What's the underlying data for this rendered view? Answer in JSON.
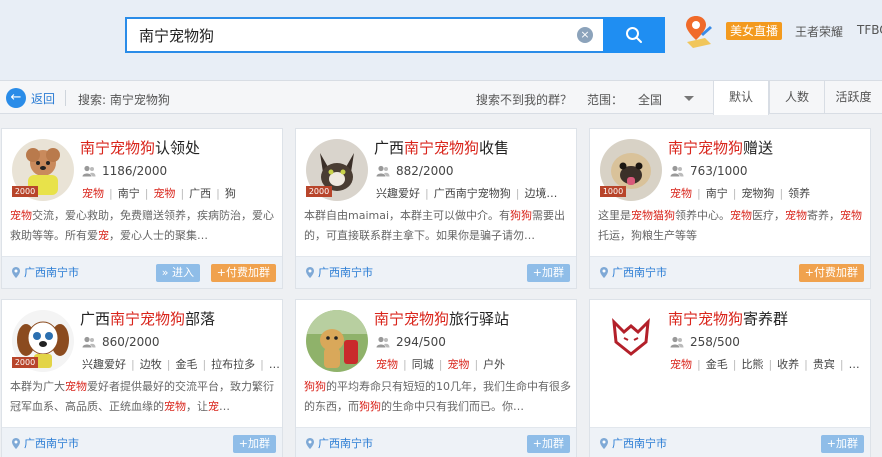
{
  "search": {
    "value": "南宁宠物狗",
    "clear_glyph": "×"
  },
  "header": {
    "live_badge": "美女直播",
    "links": [
      "王者荣耀",
      "TFBO"
    ]
  },
  "filter": {
    "back": "返回",
    "breadcrumb": "搜索: 南宁宠物狗",
    "not_found": "搜索不到我的群？",
    "range_label": "范围：",
    "range_value": "全国",
    "sort_tabs": [
      "默认",
      "人数",
      "活跃度"
    ]
  },
  "colors": {
    "accent": "#1f8ef2",
    "highlight": "#d9251c",
    "orange": "#f0a24e",
    "blue_btn": "#8fbde8"
  },
  "cards": [
    {
      "title_hl": "南宁宠物狗",
      "title_pre": "",
      "title_post": "认领处",
      "size_badge": "2000",
      "members": "1186/2000",
      "tags": [
        "宠物",
        "南宁",
        "宠物",
        "广西",
        "狗"
      ],
      "desc": "宠物交流，爱心救助，免费赠送领养，疾病防治，爱心救助等等。所有爱宠，爱心人士的聚集…",
      "location": "广西南宁市",
      "action": "» 进入",
      "action2": "+付费加群",
      "avatar": "poodle-avatar"
    },
    {
      "title_hl": "南宁宠物狗",
      "title_pre": "广西",
      "title_post": "收售",
      "size_badge": "2000",
      "members": "882/2000",
      "tags": [
        "兴趣爱好",
        "广西南宁宠物狗",
        "边境…"
      ],
      "desc": "本群自由maimai，本群主可以做中介。有狗狗需要出的，可直接联系群主拿下。如果你是骗子请勿…",
      "location": "广西南宁市",
      "action": "+加群",
      "avatar": "cat-avatar"
    },
    {
      "title_hl": "南宁宠物狗",
      "title_pre": "",
      "title_post": "赠送",
      "size_badge": "1000",
      "members": "763/1000",
      "tags": [
        "宠物",
        "南宁",
        "宠物狗",
        "领养"
      ],
      "desc": "这里是宠物猫狗领养中心。宠物医疗，宠物寄养，宠物托运，狗粮生产等等",
      "location": "广西南宁市",
      "action": "+付费加群",
      "avatar": "pug-avatar"
    },
    {
      "title_hl": "南宁宠物狗",
      "title_pre": "广西",
      "title_post": "部落",
      "size_badge": "2000",
      "members": "860/2000",
      "tags": [
        "兴趣爱好",
        "边牧",
        "金毛",
        "拉布拉多",
        "…"
      ],
      "desc": "本群为广大宠物爱好者提供最好的交流平台，致力繁衍冠军血系、高品质、正统血缘的宠物，让宠…",
      "location": "广西南宁市",
      "action": "+加群",
      "avatar": "cartoon-dog-avatar"
    },
    {
      "title_hl": "南宁宠物狗",
      "title_pre": "",
      "title_post": "旅行驿站",
      "size_badge": "",
      "members": "294/500",
      "tags": [
        "宠物",
        "同城",
        "宠物",
        "户外"
      ],
      "desc": "狗狗的平均寿命只有短短的10几年，我们生命中有很多的东西，而狗狗的生命中只有我们而已。你…",
      "location": "广西南宁市",
      "action": "+加群",
      "avatar": "golden-dog-avatar"
    },
    {
      "title_hl": "南宁宠物狗",
      "title_pre": "",
      "title_post": "寄养群",
      "size_badge": "",
      "members": "258/500",
      "tags": [
        "宠物",
        "金毛",
        "比熊",
        "收养",
        "贵宾",
        "…"
      ],
      "desc": "",
      "location": "广西南宁市",
      "action": "+加群",
      "avatar": "wolf-logo-avatar"
    }
  ]
}
